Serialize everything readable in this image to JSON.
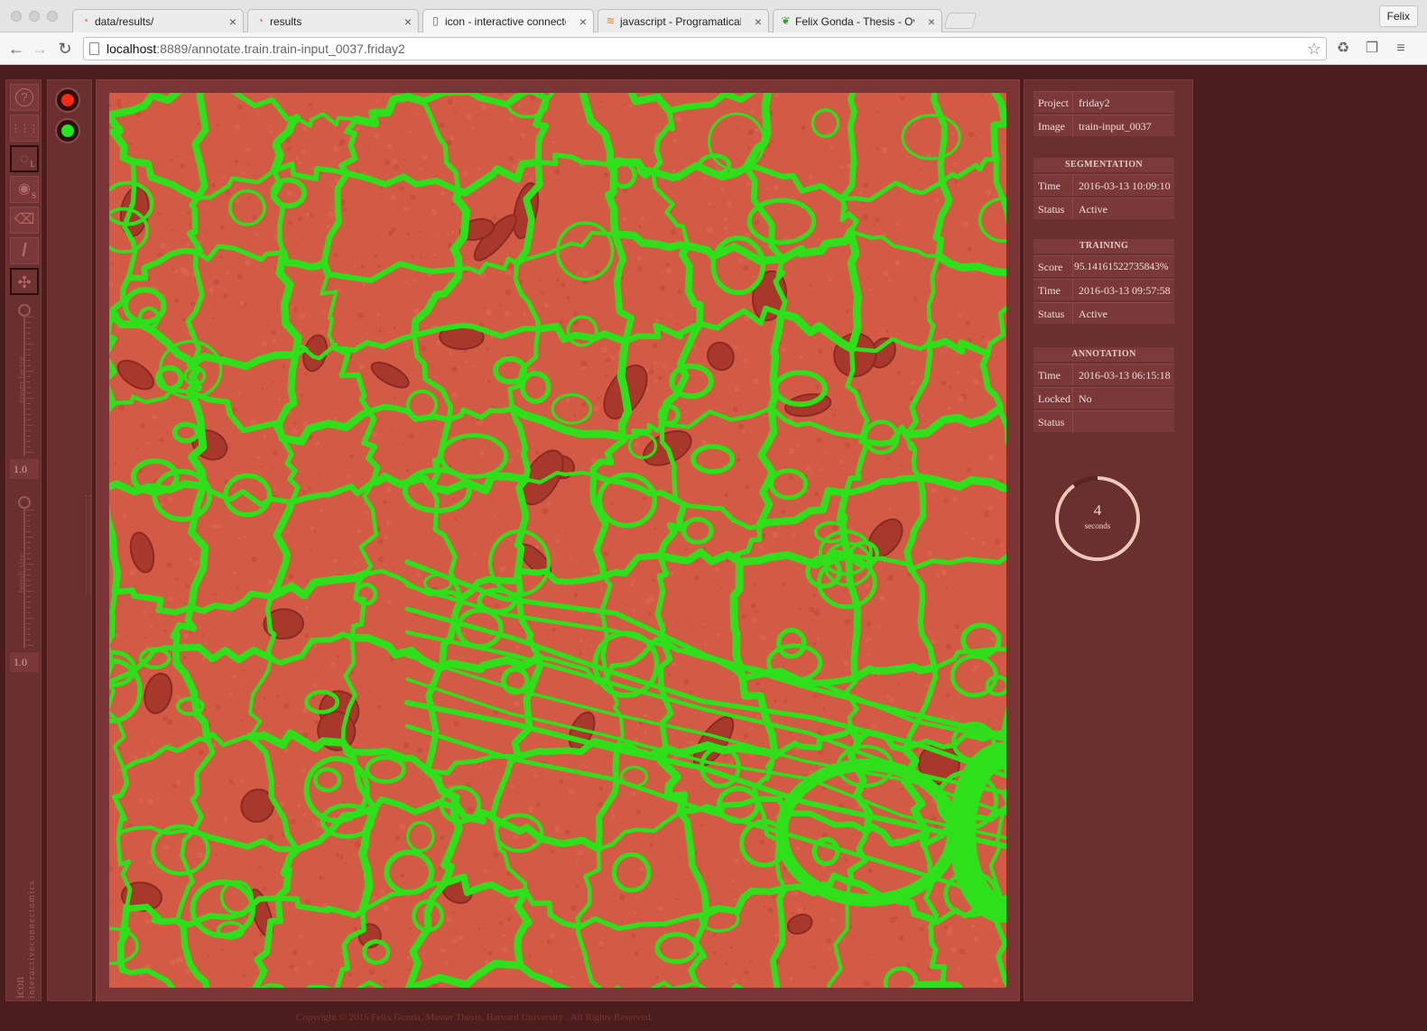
{
  "browser": {
    "tabs": [
      {
        "label": "data/results/",
        "icon": "loading-spinner-icon"
      },
      {
        "label": "results",
        "icon": "loading-spinner-icon"
      },
      {
        "label": "icon - interactive connecto",
        "icon": "page-icon"
      },
      {
        "label": "javascript - Programatically",
        "icon": "stackoverflow-icon"
      },
      {
        "label": "Felix Gonda - Thesis - Over",
        "icon": "leaf-icon"
      }
    ],
    "close_glyph": "×",
    "profile_name": "Felix",
    "url_host": "localhost",
    "url_rest": ":8889/annotate.train.train-input_0037.friday2"
  },
  "app": {
    "tools": [
      {
        "name": "help",
        "glyph": "?"
      },
      {
        "name": "grid",
        "glyph": "⋮⋮⋮"
      },
      {
        "name": "hide-labels",
        "glyph": "◌",
        "sub": "L"
      },
      {
        "name": "hide-segmentation",
        "glyph": "◉",
        "sub": "S"
      },
      {
        "name": "eraser",
        "glyph": "⌫"
      },
      {
        "name": "brush",
        "glyph": "/"
      },
      {
        "name": "pan-zoom",
        "glyph": "✣"
      }
    ],
    "zoom_slider": {
      "label": "zoom factor",
      "value": "1.0",
      "level": 1.0
    },
    "brush_slider": {
      "label": "brush size",
      "value": "1.0",
      "level": 1.0
    },
    "brand_primary": "icon",
    "brand_secondary": "interactiveconnectomics",
    "label_colors": [
      {
        "name": "red-label",
        "color": "#ff2a12"
      },
      {
        "name": "green-label",
        "color": "#22e61e"
      }
    ],
    "image": {
      "background_color": "#d35a44",
      "membrane_color": "#2ee01a",
      "organelle_color": "#a8382c"
    },
    "panel": {
      "general": [
        {
          "key": "Project",
          "value": "friday2"
        },
        {
          "key": "Image",
          "value": "train-input_0037"
        }
      ],
      "segmentation": {
        "title": "SEGMENTATION",
        "rows": [
          {
            "key": "Time",
            "value": "2016-03-13 10:09:10"
          },
          {
            "key": "Status",
            "value": "Active"
          }
        ]
      },
      "training": {
        "title": "TRAINING",
        "rows": [
          {
            "key": "Score",
            "value": "95.14161522735843%"
          },
          {
            "key": "Time",
            "value": "2016-03-13 09:57:58"
          },
          {
            "key": "Status",
            "value": "Active"
          }
        ]
      },
      "annotation": {
        "title": "ANNOTATION",
        "rows": [
          {
            "key": "Time",
            "value": "2016-03-13 06:15:18"
          },
          {
            "key": "Locked",
            "value": "No"
          },
          {
            "key": "Status",
            "value": ""
          }
        ]
      },
      "timer": {
        "value": "4",
        "unit": "seconds",
        "progress": 0.9
      }
    },
    "footer": "Copyright © 2015 Felix Gonda, Master Thesis, Harvard University . All Rights Reserved."
  }
}
